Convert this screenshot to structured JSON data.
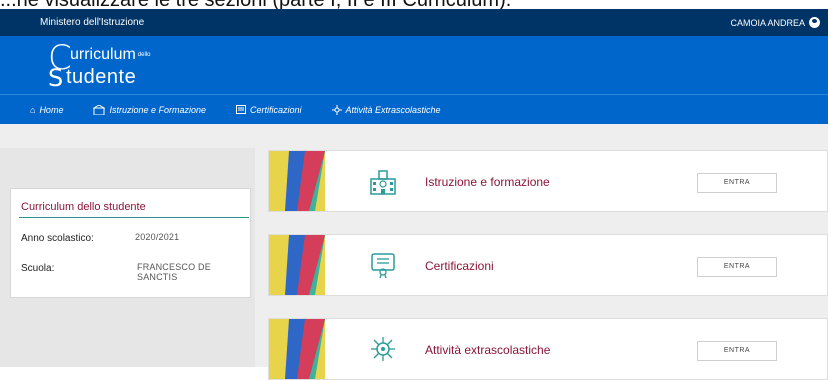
{
  "caption": "...ne visualizzare le tre sezioni (parte I, II e III Curriculum).",
  "topbar": {
    "ministry": "Ministero dell'Istruzione",
    "user_name": "CAMOIA ANDREA"
  },
  "logo": {
    "c": "C",
    "t1": "urriculum",
    "small": "dello",
    "s": "S",
    "t2": "tudente"
  },
  "nav": [
    {
      "icon": "home-icon",
      "label": "Home"
    },
    {
      "icon": "school-building-icon",
      "label": "Istruzione e Formazione"
    },
    {
      "icon": "certificate-icon",
      "label": "Certificazioni"
    },
    {
      "icon": "activities-icon",
      "label": "Attività Extrascolastiche"
    }
  ],
  "student_card": {
    "title": "Curriculum dello studente",
    "anno_label": "Anno scolastico:",
    "anno_value": "2020/2021",
    "scuola_label": "Scuola:",
    "scuola_value": "FRANCESCO DE SANCTIS"
  },
  "sections": [
    {
      "title": "Istruzione e formazione",
      "button": "ENTRA",
      "icon": "school-building-icon"
    },
    {
      "title": "Certificazioni",
      "button": "ENTRA",
      "icon": "certificate-icon"
    },
    {
      "title": "Attività extrascolastiche",
      "button": "ENTRA",
      "icon": "activities-icon"
    }
  ],
  "colors": {
    "topbar": "#003366",
    "brand": "#0066cc",
    "accent_title": "#8a1538",
    "teal": "#2f8f8f"
  }
}
